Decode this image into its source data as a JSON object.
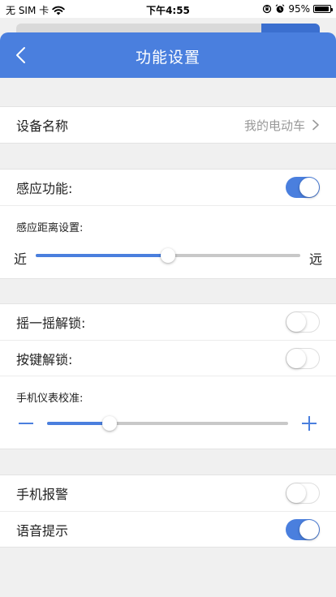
{
  "status_bar": {
    "carrier": "无 SIM 卡",
    "time": "下午4:55",
    "battery": "95%",
    "battery_level": 0.95
  },
  "header": {
    "title": "功能设置",
    "back_icon": "chevron-left-icon"
  },
  "device": {
    "label": "设备名称",
    "value": "我的电动车"
  },
  "sensing": {
    "label": "感应功能:",
    "enabled": true,
    "distance_label": "感应距离设置:",
    "near": "近",
    "far": "远",
    "distance_level": 0.5
  },
  "unlock": {
    "shake_label": "摇一摇解锁:",
    "shake_enabled": false,
    "key_label": "按键解锁:",
    "key_enabled": false,
    "calibration_label": "手机仪表校准:",
    "calibration_level": 0.26
  },
  "alerts": {
    "alarm_label": "手机报警",
    "alarm_enabled": false,
    "voice_label": "语音提示",
    "voice_enabled": true
  },
  "colors": {
    "accent": "#4a7fde",
    "background": "#f0f0f0"
  }
}
